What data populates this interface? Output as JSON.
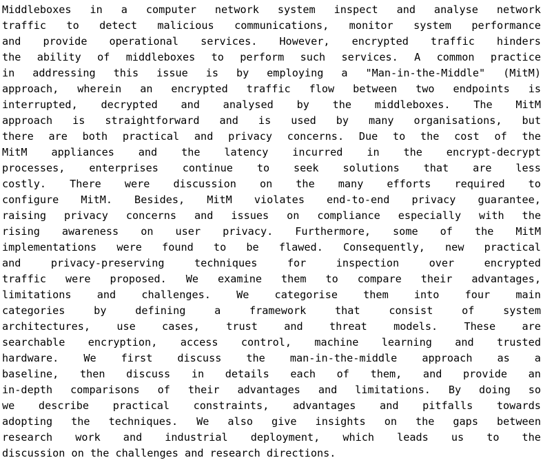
{
  "document": {
    "type": "abstract",
    "background_color": "#ffffff",
    "text_color": "#000000",
    "alignment": "justified",
    "font_style": "monospace",
    "full_text": "Middleboxes in a computer network system inspect and analyse network traffic to detect malicious communications, monitor system performance and provide operational services. However, encrypted traffic hinders the ability of middleboxes to perform such services. A common practice in addressing this issue is by employing a \"Man-in-the-Middle\" (MitM) approach, wherein an encrypted traffic flow between two endpoints is interrupted, decrypted and analysed by the middleboxes. The MitM approach is straightforward and is used by many organisations, but there are both practical and privacy concerns. Due to the cost of the MitM appliances and the latency incurred in the encrypt-decrypt processes, enterprises continue to seek solutions that are less costly. There were discussion on the many efforts required to configure MitM. Besides, MitM violates end-to-end privacy guarantee, raising privacy concerns and issues on compliance especially with the rising awareness on user privacy. Furthermore, some of the MitM implementations were found to be flawed. Consequently, new practical and privacy-preserving techniques for inspection over encrypted traffic were proposed. We examine them to compare their advantages, limitations and challenges. We categorise them into four main categories by defining a framework that consist of system architectures, use cases, trust and threat models. These are searchable encryption, access control, machine learning and trusted hardware. We first discuss the man-in-the-middle approach as a baseline, then discuss in details each of them, and provide an in-depth comparisons of their advantages and limitations. By doing so we describe practical constraints, advantages and pitfalls towards adopting the techniques. We also give insights on the gaps between research work and industrial deployment, which leads us to the discussion on the challenges and research directions.",
    "lines": [
      {
        "align": "justify",
        "words": [
          "Middleboxes",
          "in",
          "a",
          "computer",
          "network",
          "system",
          "inspect",
          "and",
          "analyse",
          "network"
        ]
      },
      {
        "align": "justify",
        "words": [
          "traffic",
          "to",
          "detect",
          "malicious",
          "communications,",
          "monitor",
          "system",
          "performance"
        ]
      },
      {
        "align": "justify",
        "words": [
          "and",
          "provide",
          "operational",
          "services.",
          "However,",
          "encrypted",
          "traffic",
          "hinders"
        ]
      },
      {
        "align": "justify",
        "words": [
          "the",
          "ability",
          "of",
          "middleboxes",
          "to",
          "perform",
          "such",
          "services.",
          "A",
          "common",
          "practice"
        ]
      },
      {
        "align": "justify",
        "words": [
          "in",
          "addressing",
          "this",
          "issue",
          "is",
          "by",
          "employing",
          "a",
          "\"Man-in-the-Middle\"",
          "(MitM)"
        ]
      },
      {
        "align": "justify",
        "words": [
          "approach,",
          "wherein",
          "an",
          "encrypted",
          "traffic",
          "flow",
          "between",
          "two",
          "endpoints",
          "is"
        ]
      },
      {
        "align": "justify",
        "words": [
          "interrupted,",
          "decrypted",
          "and",
          "analysed",
          "by",
          "the",
          "middleboxes.",
          "The",
          "MitM"
        ]
      },
      {
        "align": "justify",
        "words": [
          "approach",
          "is",
          "straightforward",
          "and",
          "is",
          "used",
          "by",
          "many",
          "organisations,",
          "but"
        ]
      },
      {
        "align": "justify",
        "words": [
          "there",
          "are",
          "both",
          "practical",
          "and",
          "privacy",
          "concerns.",
          "Due",
          "to",
          "the",
          "cost",
          "of",
          "the"
        ]
      },
      {
        "align": "justify",
        "words": [
          "MitM",
          "appliances",
          "and",
          "the",
          "latency",
          "incurred",
          "in",
          "the",
          "encrypt-decrypt"
        ]
      },
      {
        "align": "justify",
        "words": [
          "processes,",
          "enterprises",
          "continue",
          "to",
          "seek",
          "solutions",
          "that",
          "are",
          "less"
        ]
      },
      {
        "align": "justify",
        "words": [
          "costly.",
          "There",
          "were",
          "discussion",
          "on",
          "the",
          "many",
          "efforts",
          "required",
          "to"
        ]
      },
      {
        "align": "justify",
        "words": [
          "configure",
          "MitM.",
          "Besides,",
          "MitM",
          "violates",
          "end-to-end",
          "privacy",
          "guarantee,"
        ]
      },
      {
        "align": "justify",
        "words": [
          "raising",
          "privacy",
          "concerns",
          "and",
          "issues",
          "on",
          "compliance",
          "especially",
          "with",
          "the"
        ]
      },
      {
        "align": "justify",
        "words": [
          "rising",
          "awareness",
          "on",
          "user",
          "privacy.",
          "Furthermore,",
          "some",
          "of",
          "the",
          "MitM"
        ]
      },
      {
        "align": "justify",
        "words": [
          "implementations",
          "were",
          "found",
          "to",
          "be",
          "flawed.",
          "Consequently,",
          "new",
          "practical"
        ]
      },
      {
        "align": "justify",
        "words": [
          "and",
          "privacy-preserving",
          "techniques",
          "for",
          "inspection",
          "over",
          "encrypted"
        ]
      },
      {
        "align": "justify",
        "words": [
          "traffic",
          "were",
          "proposed.",
          "We",
          "examine",
          "them",
          "to",
          "compare",
          "their",
          "advantages,"
        ]
      },
      {
        "align": "justify",
        "words": [
          "limitations",
          "and",
          "challenges.",
          "We",
          "categorise",
          "them",
          "into",
          "four",
          "main"
        ]
      },
      {
        "align": "justify",
        "words": [
          "categories",
          "by",
          "defining",
          "a",
          "framework",
          "that",
          "consist",
          "of",
          "system"
        ]
      },
      {
        "align": "justify",
        "words": [
          "architectures,",
          "use",
          "cases,",
          "trust",
          "and",
          "threat",
          "models.",
          "These",
          "are"
        ]
      },
      {
        "align": "justify",
        "words": [
          "searchable",
          "encryption,",
          "access",
          "control,",
          "machine",
          "learning",
          "and",
          "trusted"
        ]
      },
      {
        "align": "justify",
        "words": [
          "hardware.",
          "We",
          "first",
          "discuss",
          "the",
          "man-in-the-middle",
          "approach",
          "as",
          "a"
        ]
      },
      {
        "align": "justify",
        "words": [
          "baseline,",
          "then",
          "discuss",
          "in",
          "details",
          "each",
          "of",
          "them,",
          "and",
          "provide",
          "an"
        ]
      },
      {
        "align": "justify",
        "words": [
          "in-depth",
          "comparisons",
          "of",
          "their",
          "advantages",
          "and",
          "limitations.",
          "By",
          "doing",
          "so"
        ]
      },
      {
        "align": "justify",
        "words": [
          "we",
          "describe",
          "practical",
          "constraints,",
          "advantages",
          "and",
          "pitfalls",
          "towards"
        ]
      },
      {
        "align": "justify",
        "words": [
          "adopting",
          "the",
          "techniques.",
          "We",
          "also",
          "give",
          "insights",
          "on",
          "the",
          "gaps",
          "between"
        ]
      },
      {
        "align": "justify",
        "words": [
          "research",
          "work",
          "and",
          "industrial",
          "deployment,",
          "which",
          "leads",
          "us",
          "to",
          "the"
        ]
      },
      {
        "align": "ragged",
        "words": [
          "discussion",
          "on",
          "the",
          "challenges",
          "and",
          "research",
          "directions."
        ]
      }
    ]
  }
}
